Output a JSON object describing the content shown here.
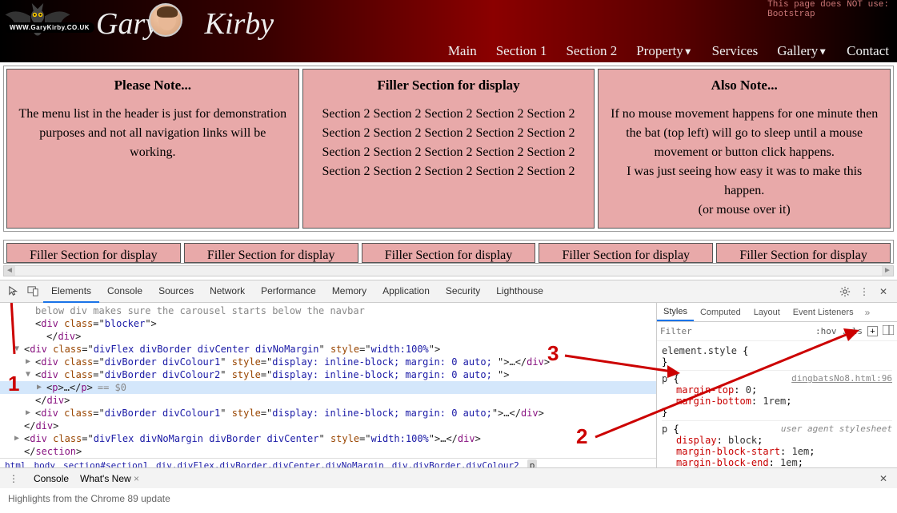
{
  "header": {
    "url_banner": "WWW.GaryKirby.CO.UK",
    "name_first": "Gary",
    "name_last": "Kirby",
    "notice_line1": "This page does NOT use:",
    "notice_line2": "Bootstrap",
    "nav": [
      "Main",
      "Section 1",
      "Section 2",
      "Property",
      "Services",
      "Gallery",
      "Contact"
    ],
    "nav_dropdown": [
      false,
      false,
      false,
      true,
      false,
      true,
      false
    ]
  },
  "boxes": [
    {
      "title": "Please Note...",
      "body": "The menu list in the header is just for demonstration purposes and not all navigation links will be working."
    },
    {
      "title": "Filler Section for display",
      "body": "Section 2 Section 2 Section 2 Section 2 Section 2 Section 2 Section 2 Section 2 Section 2 Section 2 Section 2 Section 2 Section 2 Section 2 Section 2 Section 2 Section 2 Section 2 Section 2 Section 2"
    },
    {
      "title": "Also Note...",
      "body": "If no mouse movement happens for one minute then the bat (top left) will go to sleep until a mouse movement or button click happens.\nI was just seeing how easy it was to make this happen.\n(or mouse over it)"
    }
  ],
  "filler_label": "Filler Section for display",
  "devtools": {
    "tabs": [
      "Elements",
      "Console",
      "Sources",
      "Network",
      "Performance",
      "Memory",
      "Application",
      "Security",
      "Lighthouse"
    ],
    "active_tab": "Elements",
    "elements_lines": [
      {
        "indent": 1,
        "raw": "below div makes sure the carousel starts below the navbar",
        "type": "comment-cut"
      },
      {
        "indent": 1,
        "tri": "",
        "html": "<div class=\"blocker\">"
      },
      {
        "indent": 2,
        "html": "</div>"
      },
      {
        "indent": 0,
        "tri": "▼",
        "html": "<div class=\"divFlex divBorder divCenter divNoMargin\" style=\"width:100%\">"
      },
      {
        "indent": 1,
        "tri": "▶",
        "html": "<div class=\"divBorder divColour1\" style=\"display: inline-block; margin: 0 auto; \">…</div>"
      },
      {
        "indent": 1,
        "tri": "▼",
        "html": "<div class=\"divBorder divColour2\" style=\"display: inline-block; margin: 0 auto; \">"
      },
      {
        "indent": 2,
        "tri": "▶",
        "html": "<p>…</p>",
        "selected": true,
        "suffix": "== $0"
      },
      {
        "indent": 1,
        "html": "</div>"
      },
      {
        "indent": 1,
        "tri": "▶",
        "html": "<div class=\"divBorder divColour1\" style=\"display: inline-block; margin: 0 auto;\">…</div>"
      },
      {
        "indent": 0,
        "html": "</div>"
      },
      {
        "indent": 0,
        "tri": "▶",
        "html": "<div class=\"divFlex divNoMargin divBorder divCenter\" style=\"width:100%\">…</div>"
      },
      {
        "indent": 0,
        "html": "</section>"
      }
    ],
    "crumbs": [
      "html",
      "body",
      "section#section1",
      "div.divFlex.divBorder.divCenter.divNoMargin",
      "div.divBorder.divColour2",
      "p"
    ],
    "styles_tabs": [
      "Styles",
      "Computed",
      "Layout",
      "Event Listeners"
    ],
    "styles_active": "Styles",
    "filter_placeholder": "Filter",
    "hov": ":hov",
    "cls": ".cls",
    "rules": [
      {
        "selector": "element.style",
        "props": []
      },
      {
        "selector": "p",
        "src": "dingbatsNo8.html:96",
        "props": [
          {
            "n": "margin-top",
            "v": "0"
          },
          {
            "n": "margin-bottom",
            "v": "1rem"
          }
        ]
      },
      {
        "selector": "p",
        "ua": "user agent stylesheet",
        "props": [
          {
            "n": "display",
            "v": "block"
          },
          {
            "n": "margin-block-start",
            "v": "1em"
          },
          {
            "n": "margin-block-end",
            "v": "1em"
          }
        ]
      }
    ],
    "bottom_tabs": [
      "Console",
      "What's New"
    ],
    "bottom_active": "What's New",
    "footer": "Highlights from the Chrome 89 update"
  },
  "annotations": {
    "a1": "1",
    "a2": "2",
    "a3": "3"
  }
}
